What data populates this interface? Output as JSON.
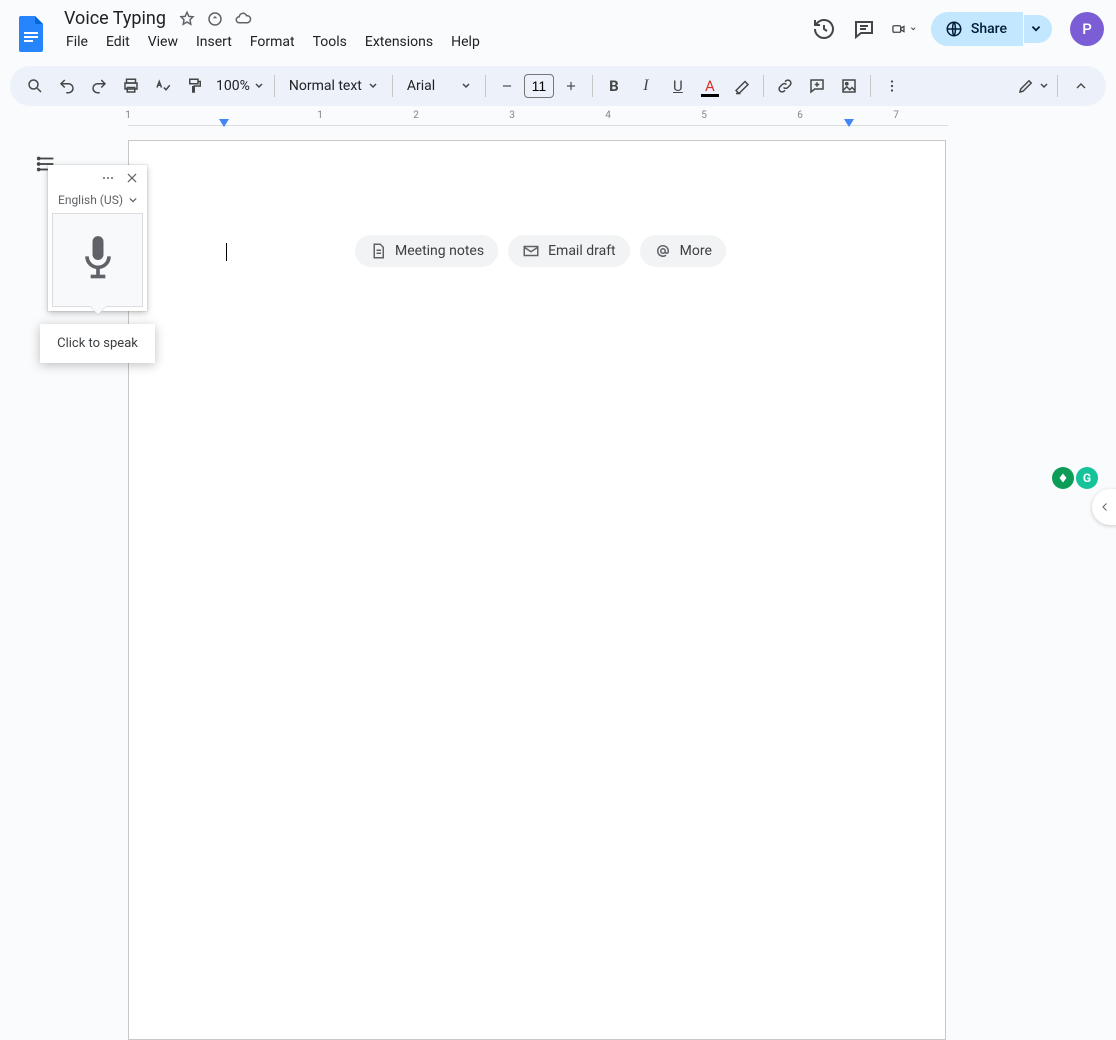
{
  "doc": {
    "title": "Voice Typing"
  },
  "menus": [
    "File",
    "Edit",
    "View",
    "Insert",
    "Format",
    "Tools",
    "Extensions",
    "Help"
  ],
  "header": {
    "share_label": "Share",
    "avatar_letter": "P"
  },
  "toolbar": {
    "zoom": "100%",
    "style": "Normal text",
    "font": "Arial",
    "font_size": "11"
  },
  "ruler": {
    "numbers": [
      "1",
      "1",
      "2",
      "3",
      "4",
      "5",
      "6",
      "7"
    ]
  },
  "suggestions": {
    "meeting_notes": "Meeting notes",
    "email_draft": "Email draft",
    "more": "More"
  },
  "voice": {
    "language": "English (US)",
    "tooltip": "Click to speak"
  },
  "icons": {
    "star": "star-icon",
    "bell": "activity-icon",
    "cloud": "cloud-saved-icon"
  },
  "ext": {
    "grammarly": "G"
  }
}
